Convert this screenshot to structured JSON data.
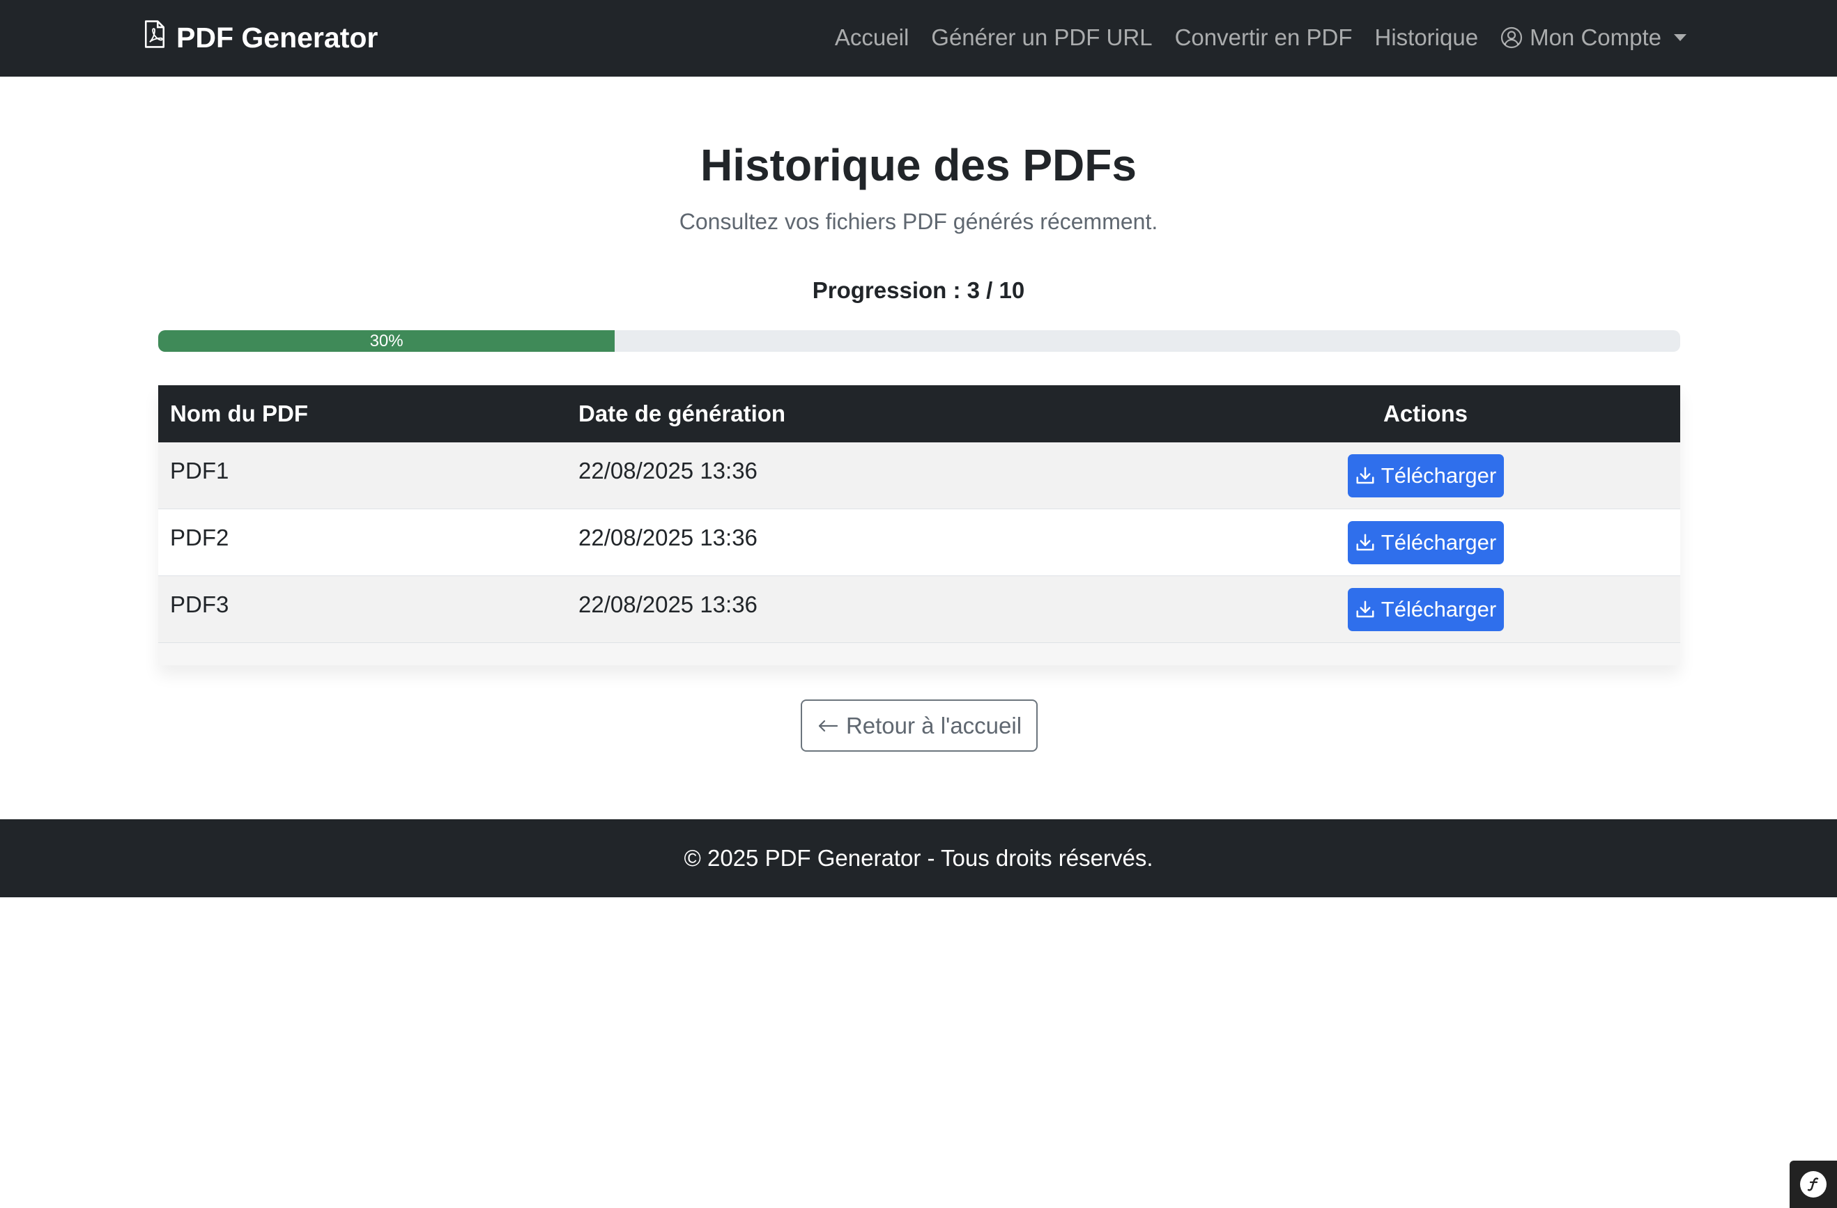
{
  "navbar": {
    "brand": "PDF Generator",
    "brand_icon": "file-pdf-icon",
    "links": [
      {
        "label": "Accueil"
      },
      {
        "label": "Générer un PDF URL"
      },
      {
        "label": "Convertir en PDF"
      },
      {
        "label": "Historique"
      }
    ],
    "account": {
      "label": "Mon Compte",
      "icon": "person-circle-icon"
    }
  },
  "page": {
    "title": "Historique des PDFs",
    "subtitle": "Consultez vos fichiers PDF générés récemment."
  },
  "progress": {
    "label": "Progression : 3 / 10",
    "text": "30%",
    "value": 0.3,
    "color": "#3f8a58"
  },
  "table": {
    "headers": [
      "Nom du PDF",
      "Date de génération",
      "Actions"
    ],
    "rows": [
      {
        "name": "PDF1",
        "date": "22/08/2025 13:36",
        "action": "Télécharger"
      },
      {
        "name": "PDF2",
        "date": "22/08/2025 13:36",
        "action": "Télécharger"
      },
      {
        "name": "PDF3",
        "date": "22/08/2025 13:36",
        "action": "Télécharger"
      }
    ],
    "action_icon": "download-icon",
    "action_color": "#2f6fec"
  },
  "back_button": {
    "label": "Retour à l'accueil",
    "icon": "arrow-left-icon"
  },
  "footer": {
    "text": "© 2025 PDF Generator - Tous droits réservés."
  },
  "debug_toolbar": {
    "icon": "symfony-icon"
  },
  "colors": {
    "navbar": "#212529",
    "footer": "#212529",
    "primary": "#2f6fec"
  }
}
